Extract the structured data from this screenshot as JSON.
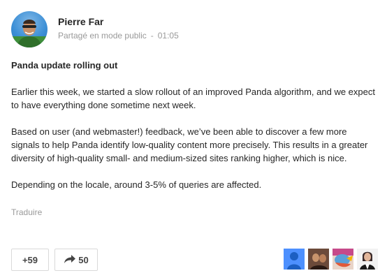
{
  "post": {
    "author": "Pierre Far",
    "visibility": "Partagé en mode public",
    "separator": "-",
    "time": "01:05",
    "title": "Panda update rolling out",
    "paragraphs": [
      "Earlier this week, we started a slow rollout of an improved Panda algorithm, and we expect to have everything done sometime next week.",
      "Based on user (and webmaster!) feedback, we’ve been able to discover a few more signals to help Panda identify low-quality content more precisely. This results in a greater diversity of high-quality small- and medium-sized sites ranking higher, which is nice.",
      "Depending on the locale, around 3-5% of queries are affected."
    ],
    "translate_label": "Traduire"
  },
  "actions": {
    "plusone_label": "+59",
    "share_count": "50",
    "share_icon": "share-arrow-icon"
  },
  "reshared_by": [
    {
      "icon": "default-avatar-icon",
      "color": "#4d90fe"
    },
    {
      "icon": "photo-avatar-icon",
      "color": "#6b4a3a"
    },
    {
      "icon": "bird-avatar-icon",
      "color": "#5aa0d8"
    },
    {
      "icon": "photo-avatar-icon",
      "color": "#3a2a2a"
    }
  ]
}
